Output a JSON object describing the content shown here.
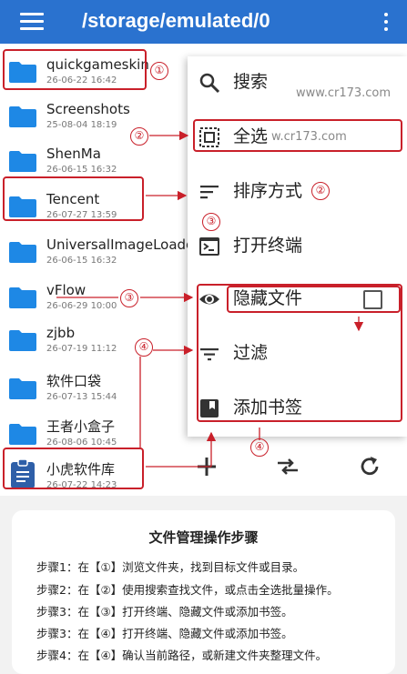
{
  "appbar": {
    "title": "/storage/emulated/0",
    "menu_icon": "hamburger-menu-icon",
    "overflow_icon": "more-vertical-icon"
  },
  "files": [
    {
      "name": "quickgameskin",
      "date": "26-06-22 16:42",
      "icon": "folder-icon"
    },
    {
      "name": "Screenshots",
      "date": "25-08-04 18:19",
      "icon": "folder-icon"
    },
    {
      "name": "ShenMa",
      "date": "26-06-15 16:32",
      "icon": "folder-icon"
    },
    {
      "name": "Tencent",
      "date": "26-07-27 13:59",
      "icon": "folder-icon"
    },
    {
      "name": "UniversalImageLoade",
      "date": "26-06-15 16:32",
      "icon": "folder-icon"
    },
    {
      "name": "vFlow",
      "date": "26-06-29 10:00",
      "icon": "folder-icon"
    },
    {
      "name": "zjbb",
      "date": "26-07-19 11:12",
      "icon": "folder-icon"
    },
    {
      "name": "软件口袋",
      "date": "26-07-13 15:44",
      "icon": "folder-icon"
    },
    {
      "name": "王者小盒子",
      "date": "26-08-06 10:45",
      "icon": "folder-icon"
    },
    {
      "name": "小虎软件库",
      "date": "26-07-22 14:23",
      "icon": "clipboard-icon"
    }
  ],
  "menu": {
    "items": [
      {
        "label": "搜索",
        "icon": "search-icon"
      },
      {
        "label": "全选",
        "icon": "select-all-icon"
      },
      {
        "label": "排序方式",
        "icon": "sort-icon"
      },
      {
        "label": "打开终端",
        "icon": "terminal-icon"
      },
      {
        "label": "隐藏文件",
        "icon": "eye-icon",
        "checked": false
      },
      {
        "label": "过滤",
        "icon": "filter-icon"
      },
      {
        "label": "添加书签",
        "icon": "bookmark-icon"
      }
    ],
    "watermark1": "www.cr173.com",
    "watermark2": "w.cr173.com"
  },
  "toolbar": {
    "add_icon": "plus-icon",
    "swap_icon": "swap-arrows-icon",
    "refresh_icon": "refresh-icon"
  },
  "annotations": {
    "n1": "①",
    "n2": "②",
    "n3": "③",
    "n4": "④"
  },
  "steps": {
    "title": "文件管理操作步骤",
    "lines": [
      "步骤1：在【①】浏览文件夹，找到目标文件或目录。",
      "步骤2：在【②】使用搜索查找文件，或点击全选批量操作。",
      "步骤3：在【③】打开终端、隐藏文件或添加书签。",
      "步骤3：在【④】打开终端、隐藏文件或添加书签。",
      "步骤4：在【④】确认当前路径，或新建文件夹整理文件。"
    ]
  },
  "colors": {
    "appbar": "#2a72cf",
    "folder": "#1e88e5",
    "annotation": "#c9202a"
  }
}
